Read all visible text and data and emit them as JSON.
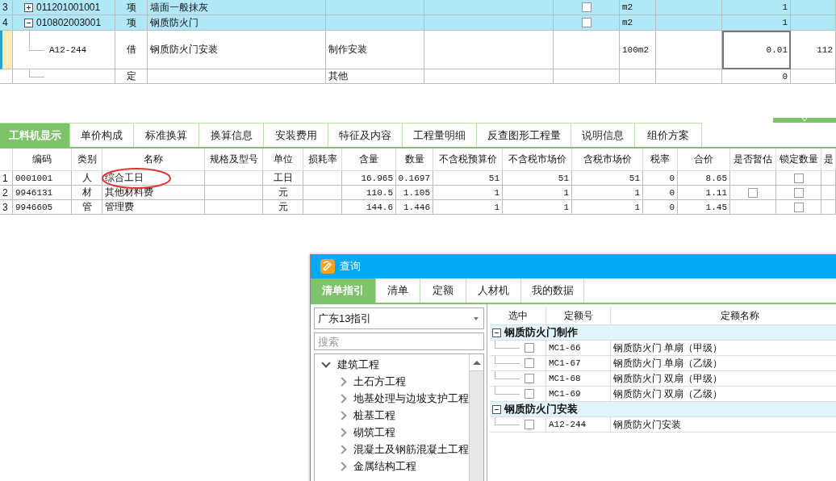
{
  "bill_grid": {
    "rows": [
      {
        "kind": "item",
        "num": "3",
        "code": "011201001001",
        "expanded": false,
        "category": "项",
        "name": "墙面一般抹灰",
        "checked": false,
        "unit": "m2",
        "quantity": "1",
        "selected": false
      },
      {
        "kind": "item",
        "num": "4",
        "code": "010802003001",
        "expanded": true,
        "category": "项",
        "name": "钢质防火门",
        "checked": false,
        "unit": "m2",
        "quantity": "1",
        "selected": false
      },
      {
        "kind": "sub",
        "code": "A12-244",
        "category": "借",
        "name": "钢质防火门安装",
        "col_4": "制作安装",
        "unit": "100m2",
        "quantity": "0.01",
        "col_11": "112",
        "selected": true
      },
      {
        "kind": "sub",
        "category": "定",
        "col_4": "其他",
        "quantity": "0",
        "selected": false
      }
    ]
  },
  "detail_tabs": [
    {
      "label": "工料机显示",
      "selected": true
    },
    {
      "label": "单价构成",
      "selected": false
    },
    {
      "label": "标准换算",
      "selected": false
    },
    {
      "label": "换算信息",
      "selected": false
    },
    {
      "label": "安装费用",
      "selected": false
    },
    {
      "label": "特征及内容",
      "selected": false
    },
    {
      "label": "工程量明细",
      "selected": false
    },
    {
      "label": "反查图形工程量",
      "selected": false
    },
    {
      "label": "说明信息",
      "selected": false
    },
    {
      "label": "组价方案",
      "selected": false
    }
  ],
  "resource_grid": {
    "columns": [
      "编码",
      "类别",
      "名称",
      "规格及型号",
      "单位",
      "损耗率",
      "含量",
      "数量",
      "不含税预算价",
      "不含税市场价",
      "含税市场价",
      "税率",
      "合价",
      "是否暂估",
      "锁定数量",
      "是"
    ],
    "rows": [
      {
        "num": "1",
        "code": "0001001",
        "category": "人",
        "name": "综合工日",
        "unit": "工日",
        "content": "16.965",
        "quantity": "0.1697",
        "pretax_budget": "51",
        "pretax_market": "51",
        "taxed_market": "51",
        "tax_rate": "0",
        "total": "8.65",
        "locked": false
      },
      {
        "num": "2",
        "code": "9946131",
        "category": "材",
        "name": "其他材料费",
        "unit": "元",
        "content": "110.5",
        "quantity": "1.105",
        "pretax_budget": "1",
        "pretax_market": "1",
        "taxed_market": "1",
        "tax_rate": "0",
        "total": "1.11",
        "estimated": false,
        "locked": false
      },
      {
        "num": "3",
        "code": "9946605",
        "category": "管",
        "name": "管理费",
        "unit": "元",
        "content": "144.6",
        "quantity": "1.446",
        "pretax_budget": "1",
        "pretax_market": "1",
        "taxed_market": "1",
        "tax_rate": "0",
        "total": "1.45",
        "locked": false
      }
    ]
  },
  "query_dialog": {
    "title": "查询",
    "tabs": [
      {
        "label": "清单指引",
        "selected": true
      },
      {
        "label": "清单",
        "selected": false
      },
      {
        "label": "定额",
        "selected": false
      },
      {
        "label": "人材机",
        "selected": false
      },
      {
        "label": "我的数据",
        "selected": false
      }
    ],
    "library_select": "广东13指引",
    "search": {
      "placeholder": "搜索"
    },
    "tree": [
      {
        "label": "建筑工程",
        "expanded": true,
        "children": [
          {
            "label": "土石方工程",
            "expanded": false
          },
          {
            "label": "地基处理与边坡支护工程",
            "expanded": false
          },
          {
            "label": "桩基工程",
            "expanded": false
          },
          {
            "label": "砌筑工程",
            "expanded": false
          },
          {
            "label": "混凝土及钢筋混凝土工程",
            "expanded": false
          },
          {
            "label": "金属结构工程",
            "expanded": false
          }
        ]
      }
    ],
    "quota_table": {
      "columns": [
        "选中",
        "定额号",
        "定额名称"
      ],
      "groups": [
        {
          "name": "钢质防火门制作",
          "expanded": true,
          "items": [
            {
              "code": "MC1-66",
              "name": "钢质防火门 单扇（甲级）",
              "checked": false
            },
            {
              "code": "MC1-67",
              "name": "钢质防火门 单扇（乙级）",
              "checked": false
            },
            {
              "code": "MC1-68",
              "name": "钢质防火门 双扇（甲级）",
              "checked": false
            },
            {
              "code": "MC1-69",
              "name": "钢质防火门 双扇（乙级）",
              "checked": false
            }
          ]
        },
        {
          "name": "钢质防火门安装",
          "expanded": true,
          "items": [
            {
              "code": "A12-244",
              "name": "钢质防火门安装",
              "checked": false
            }
          ]
        }
      ]
    }
  }
}
